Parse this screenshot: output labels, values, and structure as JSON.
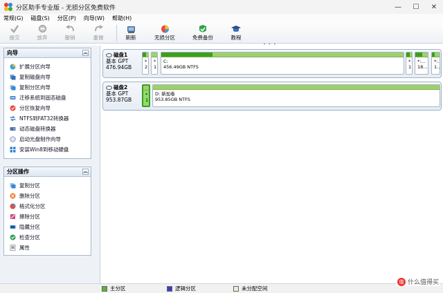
{
  "window": {
    "title": "分区助手专业版 - 无损分区免费软件",
    "minimize": "—",
    "maximize": "☐",
    "close": "✕"
  },
  "menu": [
    "常规(G)",
    "磁盘(S)",
    "分区(P)",
    "向导(W)",
    "帮助(H)"
  ],
  "toolbar": {
    "commit": "提交",
    "discard": "放弃",
    "undo": "撤销",
    "redo": "重做",
    "refresh": "刷新",
    "no_loss": "无损分区",
    "backup": "免费备份",
    "tutorial": "教程"
  },
  "wizard_panel": {
    "title": "向导",
    "items": [
      "扩展分区向导",
      "复制磁盘向导",
      "复制分区向导",
      "迁移系统到固态磁盘",
      "分区恢复向导",
      "NTFS到FAT32转换器",
      "动态磁盘转换器",
      "启动光盘制作向导",
      "安装Win8到移动硬盘"
    ]
  },
  "ops_panel": {
    "title": "分区操作",
    "items": [
      "复制分区",
      "删除分区",
      "格式化分区",
      "擦除分区",
      "隐藏分区",
      "检查分区",
      "属性"
    ]
  },
  "disk1": {
    "name": "磁盘1",
    "type": "基本 GPT",
    "size": "476.94GB",
    "parts": [
      {
        "top": "*",
        "bottom": "2",
        "used": 0.6
      },
      {
        "top": "*",
        "bottom": "1",
        "used": 0.0
      },
      {
        "top": "C:",
        "bottom": "456.49GB NTFS",
        "used": 0.21
      },
      {
        "top": "*",
        "bottom": "1",
        "used": 0.6
      },
      {
        "top": "*:...",
        "bottom": "18...",
        "used": 0.55
      },
      {
        "top": "*:...",
        "bottom": "1...",
        "used": 0.35
      }
    ]
  },
  "disk2": {
    "name": "磁盘2",
    "type": "基本 GPT",
    "size": "953.87GB",
    "parts": [
      {
        "top": "*",
        "bottom": "1",
        "used": 0.0
      },
      {
        "top": "D: 新加卷",
        "bottom": "953.85GB NTFS",
        "used": 0.0
      }
    ]
  },
  "legend": {
    "primary": "主分区",
    "logical": "逻辑分区",
    "unallocated": "未分配空间"
  },
  "watermark": "值 什么值得买",
  "colors": {
    "used_fill": "#3aa01a",
    "free_fill": "#9fd06f",
    "primary": "#5cb338",
    "logical": "#3c3ccc",
    "unallocated": "#f0ead8"
  }
}
